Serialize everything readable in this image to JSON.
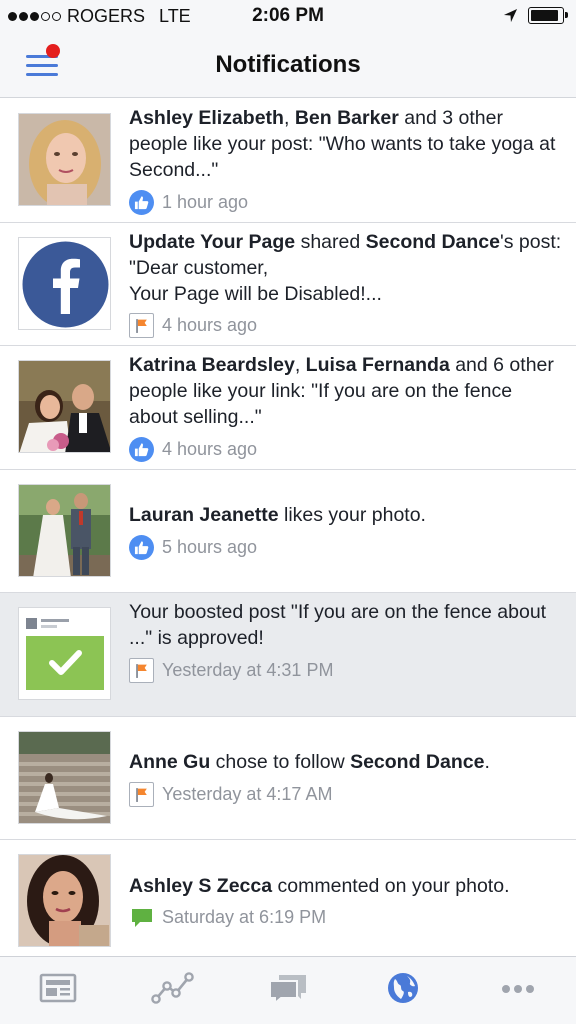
{
  "status_bar": {
    "carrier": "ROGERS",
    "network": "LTE",
    "time": "2:06 PM",
    "signal_bars_filled": 3,
    "signal_bars_total": 5,
    "battery_level": 0.9
  },
  "header": {
    "title": "Notifications",
    "menu_icon": "hamburger-menu-icon",
    "has_unread_badge": true
  },
  "notifications": [
    {
      "thumb": "photo-woman-blonde",
      "parts": [
        {
          "b": true,
          "t": "Ashley Elizabeth"
        },
        {
          "b": false,
          "t": ", "
        },
        {
          "b": true,
          "t": "Ben Barker"
        },
        {
          "b": false,
          "t": " and 3 other people like your post: \"Who wants to take yoga at Second...\""
        }
      ],
      "type_icon": "like-icon",
      "time": "1 hour ago",
      "highlighted": false
    },
    {
      "thumb": "facebook-logo",
      "parts": [
        {
          "b": true,
          "t": "Update Your Page"
        },
        {
          "b": false,
          "t": " shared "
        },
        {
          "b": true,
          "t": "Second Dance"
        },
        {
          "b": false,
          "t": "'s post: \"Dear customer,\nYour Page will be Disabled!..."
        }
      ],
      "type_icon": "page-flag-icon",
      "time": "4 hours ago",
      "highlighted": false
    },
    {
      "thumb": "photo-couple-wedding",
      "parts": [
        {
          "b": true,
          "t": "Katrina Beardsley"
        },
        {
          "b": false,
          "t": ", "
        },
        {
          "b": true,
          "t": "Luisa Fernanda"
        },
        {
          "b": false,
          "t": " and 6 other people like your link: \"If you are on the fence about selling...\""
        }
      ],
      "type_icon": "like-icon",
      "time": "4 hours ago",
      "highlighted": false
    },
    {
      "thumb": "photo-wedding-couple-outdoors",
      "parts": [
        {
          "b": true,
          "t": "Lauran Jeanette"
        },
        {
          "b": false,
          "t": " likes your photo."
        }
      ],
      "type_icon": "like-icon",
      "time": "5 hours ago",
      "highlighted": false
    },
    {
      "thumb": "boosted-post-approved",
      "parts": [
        {
          "b": false,
          "t": "Your boosted post \"If you are on the fence about ...\" is approved!"
        }
      ],
      "type_icon": "page-flag-icon",
      "time": "Yesterday at 4:31 PM",
      "highlighted": true
    },
    {
      "thumb": "photo-bride-stairs",
      "parts": [
        {
          "b": true,
          "t": "Anne Gu"
        },
        {
          "b": false,
          "t": " chose to follow "
        },
        {
          "b": true,
          "t": "Second Dance"
        },
        {
          "b": false,
          "t": "."
        }
      ],
      "type_icon": "page-flag-icon",
      "time": "Yesterday at 4:17 AM",
      "highlighted": false
    },
    {
      "thumb": "photo-woman-dark-hair",
      "parts": [
        {
          "b": true,
          "t": "Ashley S Zecca"
        },
        {
          "b": false,
          "t": " commented on your photo."
        }
      ],
      "type_icon": "comment-icon",
      "time": "Saturday at 6:19 PM",
      "highlighted": false
    }
  ],
  "tab_bar": [
    {
      "icon": "news-feed-icon",
      "active": false
    },
    {
      "icon": "insights-icon",
      "active": false
    },
    {
      "icon": "messages-icon",
      "active": false
    },
    {
      "icon": "notifications-globe-icon",
      "active": true
    },
    {
      "icon": "more-icon",
      "active": false
    }
  ],
  "colors": {
    "accent": "#4a7ad8",
    "like_blue": "#4e8ef2",
    "badge_red": "#e41e1e",
    "highlight_bg": "#e9ebee",
    "meta_gray": "#90949c",
    "flag_orange": "#f5862f",
    "comment_green": "#5fb141",
    "facebook_blue": "#3b5998"
  }
}
